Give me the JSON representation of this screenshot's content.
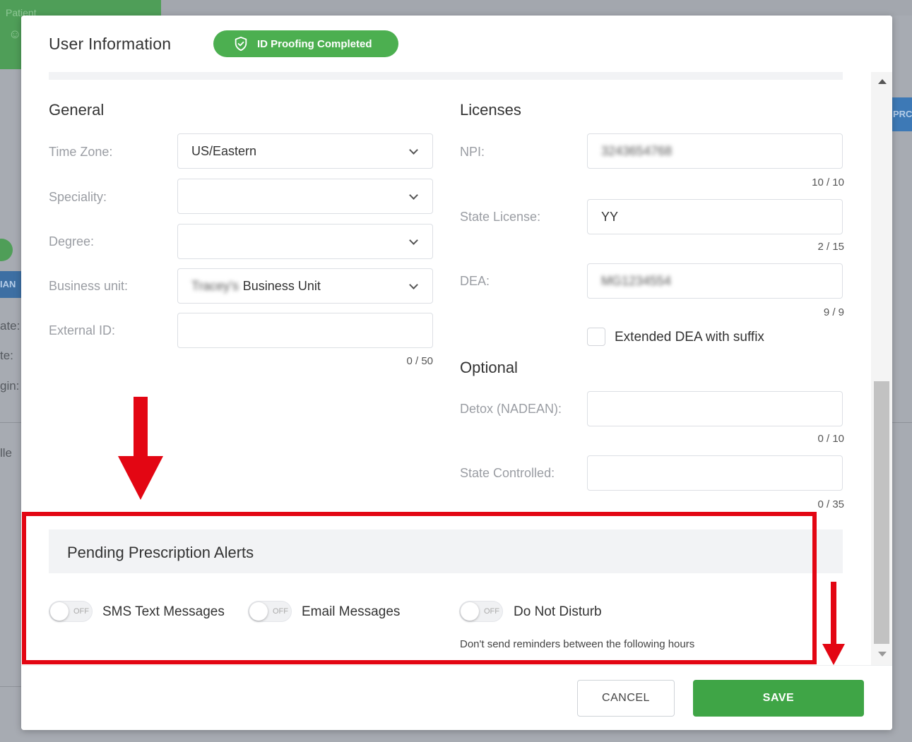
{
  "background": {
    "tab_label": "Patient",
    "side_tag": "IAN",
    "side_button": "PRC",
    "side_texts": [
      "ate:",
      "te:",
      "gin:",
      "lle"
    ]
  },
  "modal": {
    "title": "User Information",
    "badge": "ID Proofing Completed"
  },
  "general": {
    "title": "General",
    "time_zone": {
      "label": "Time Zone:",
      "value": "US/Eastern"
    },
    "speciality": {
      "label": "Speciality:",
      "value": ""
    },
    "degree": {
      "label": "Degree:",
      "value": ""
    },
    "business_unit": {
      "label": "Business unit:",
      "value_blurred": "Tracey's",
      "value": "Business Unit"
    },
    "external_id": {
      "label": "External ID:",
      "value": "",
      "counter": "0 / 50"
    }
  },
  "licenses": {
    "title": "Licenses",
    "npi": {
      "label": "NPI:",
      "value_blurred": "3243654768",
      "counter": "10 / 10"
    },
    "state_license": {
      "label": "State License:",
      "value": "YY",
      "counter": "2 / 15"
    },
    "dea": {
      "label": "DEA:",
      "value_blurred": "MG1234554",
      "counter": "9 / 9"
    },
    "extended_dea": {
      "label": "Extended DEA with suffix",
      "checked": false
    }
  },
  "optional": {
    "title": "Optional",
    "detox": {
      "label": "Detox (NADEAN):",
      "value": "",
      "counter": "0 / 10"
    },
    "state_controlled": {
      "label": "State Controlled:",
      "value": "",
      "counter": "0 / 35"
    }
  },
  "alerts": {
    "title": "Pending Prescription Alerts",
    "toggle_state": "OFF",
    "sms": "SMS Text Messages",
    "email": "Email Messages",
    "dnd": "Do Not Disturb",
    "dnd_note": "Don't send reminders between the following hours"
  },
  "footer": {
    "cancel": "CANCEL",
    "save": "SAVE"
  },
  "colors": {
    "primary_green": "#4caf50",
    "save_green": "#3fa546",
    "annotation_red": "#e30613"
  }
}
